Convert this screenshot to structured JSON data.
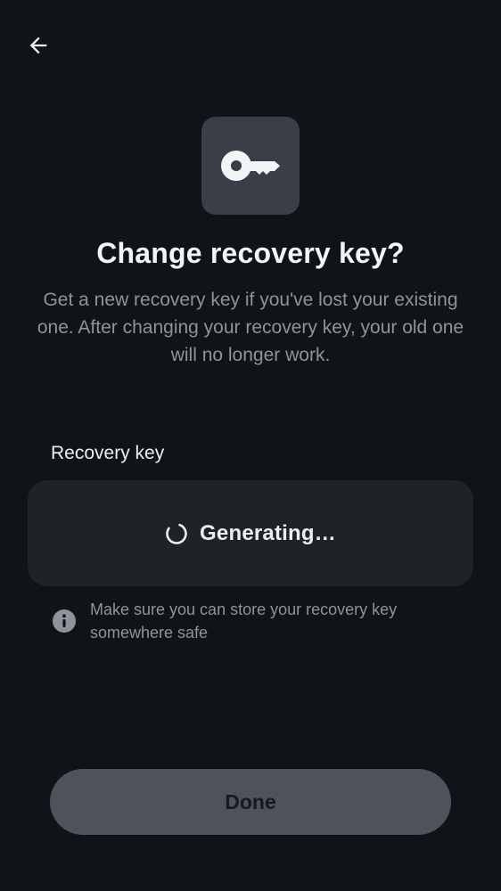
{
  "header": {
    "back_icon": "arrow-left-icon"
  },
  "hero": {
    "icon": "key-icon",
    "title": "Change recovery key?",
    "description": "Get a new recovery key if you've lost your existing one. After changing your recovery key, your old one will no longer work."
  },
  "recovery_key": {
    "label": "Recovery key",
    "status_icon": "spinner-icon",
    "status_text": "Generating…"
  },
  "hint": {
    "icon": "info-icon",
    "text": "Make sure you can store your recovery key somewhere safe"
  },
  "footer": {
    "done_label": "Done"
  },
  "colors": {
    "background": "#101317",
    "tile": "#3a3f47",
    "field": "#1f2227",
    "button_disabled": "#4e535b",
    "secondary_text": "#8e949c",
    "primary_text": "#ebeef2"
  }
}
